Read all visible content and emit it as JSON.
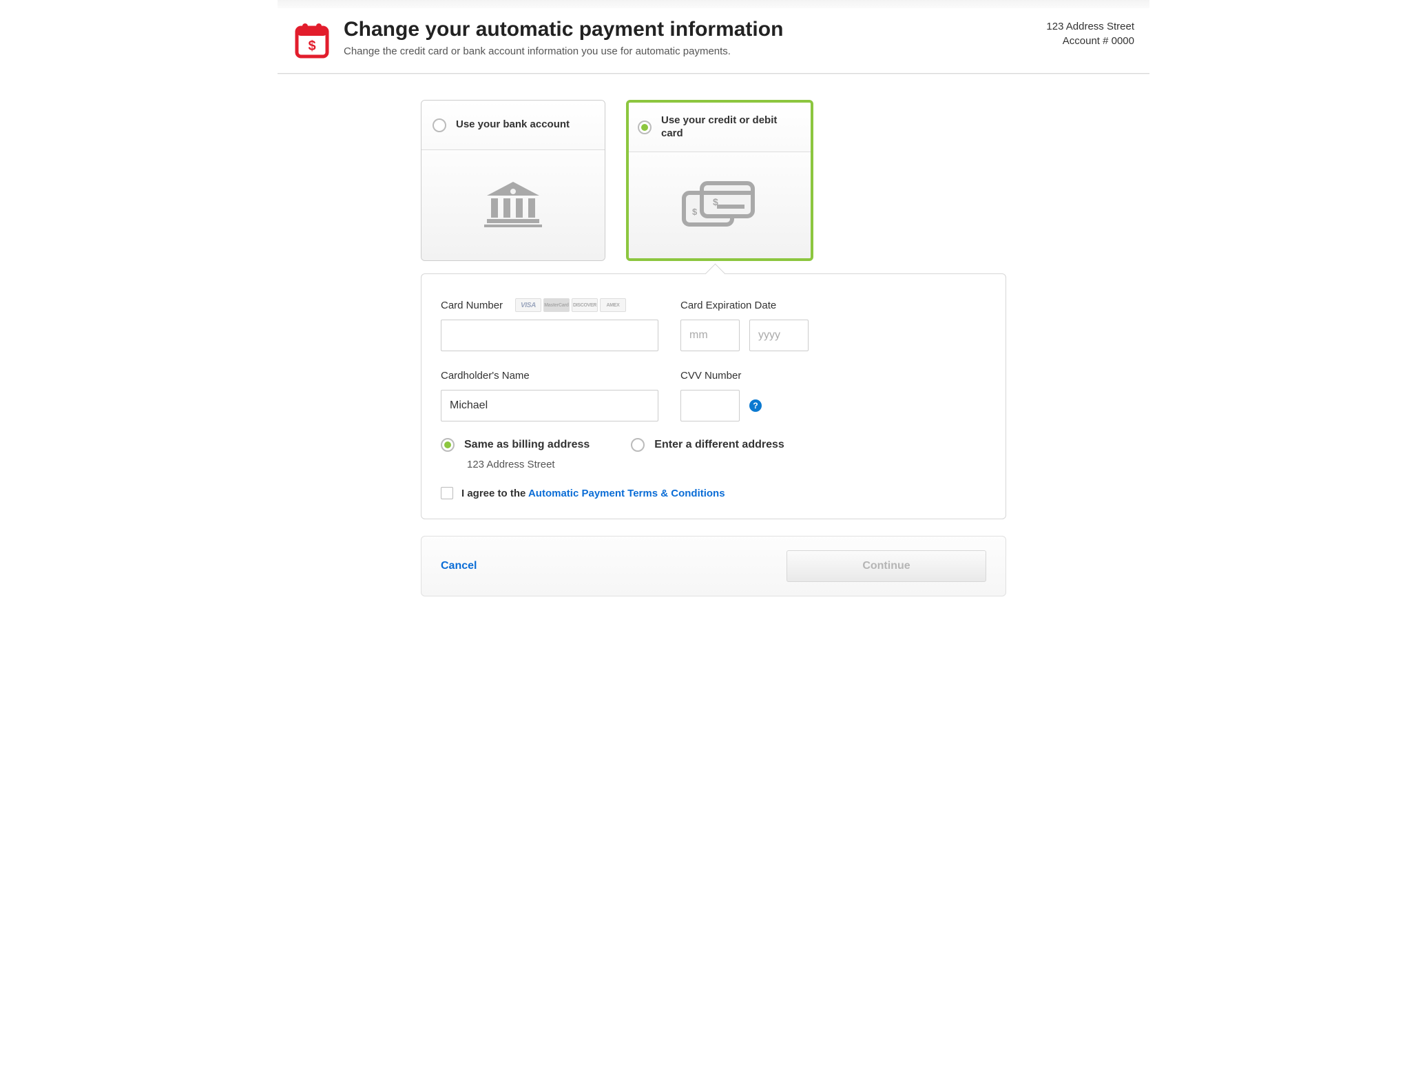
{
  "header": {
    "title": "Change your automatic payment information",
    "subtitle": "Change the credit card or bank account information you use for automatic payments."
  },
  "account": {
    "address_line": "123 Address Street",
    "number_line": "Account # 0000"
  },
  "options": {
    "bank": {
      "label": "Use your bank account",
      "selected": false
    },
    "card": {
      "label": "Use your credit or debit card",
      "selected": true
    }
  },
  "form": {
    "card_number_label": "Card Number",
    "card_logos": [
      "VISA",
      "MasterCard",
      "DISCOVER",
      "AMEX"
    ],
    "card_number_value": "",
    "exp_label": "Card Expiration Date",
    "exp_month_placeholder": "mm",
    "exp_month_value": "",
    "exp_year_placeholder": "yyyy",
    "exp_year_value": "",
    "name_label": "Cardholder's Name",
    "name_value": "Michael",
    "cvv_label": "CVV Number",
    "cvv_value": "",
    "help_icon": "?",
    "addr_same_label": "Same as billing address",
    "billing_address": "123 Address Street",
    "addr_diff_label": "Enter a different address",
    "terms_prefix": "I agree to the ",
    "terms_link": "Automatic Payment Terms & Conditions"
  },
  "actions": {
    "cancel": "Cancel",
    "continue": "Continue"
  }
}
